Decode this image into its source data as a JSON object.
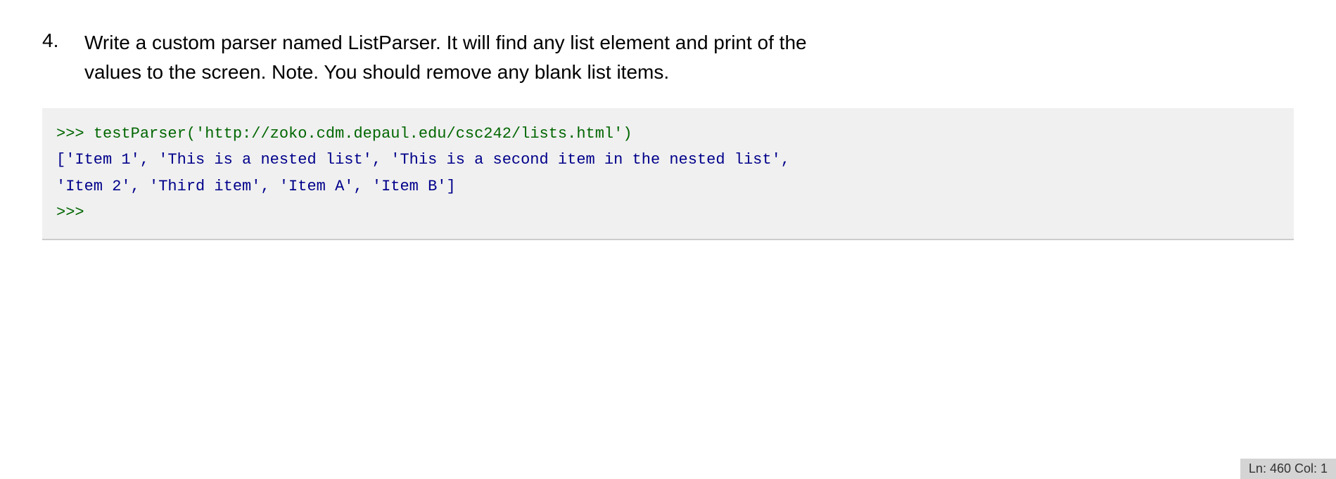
{
  "question": {
    "number": "4.",
    "text_line1": "Write a custom parser named ListParser. It will find any list element and print of the",
    "text_line2": "values to the screen.  Note. You should remove any blank list items."
  },
  "code": {
    "prompt_symbol": ">>> ",
    "function_call": "testParser('http://zoko.cdm.depaul.edu/csc242/lists.html')",
    "output_line1": "['Item 1', 'This is a nested list', 'This is a second item in the nested list',",
    "output_line2": "'Item 2', 'Third item', 'Item A', 'Item B']",
    "prompt_end": ">>>"
  },
  "status_bar": {
    "text": "Ln: 460  Col: 1"
  }
}
